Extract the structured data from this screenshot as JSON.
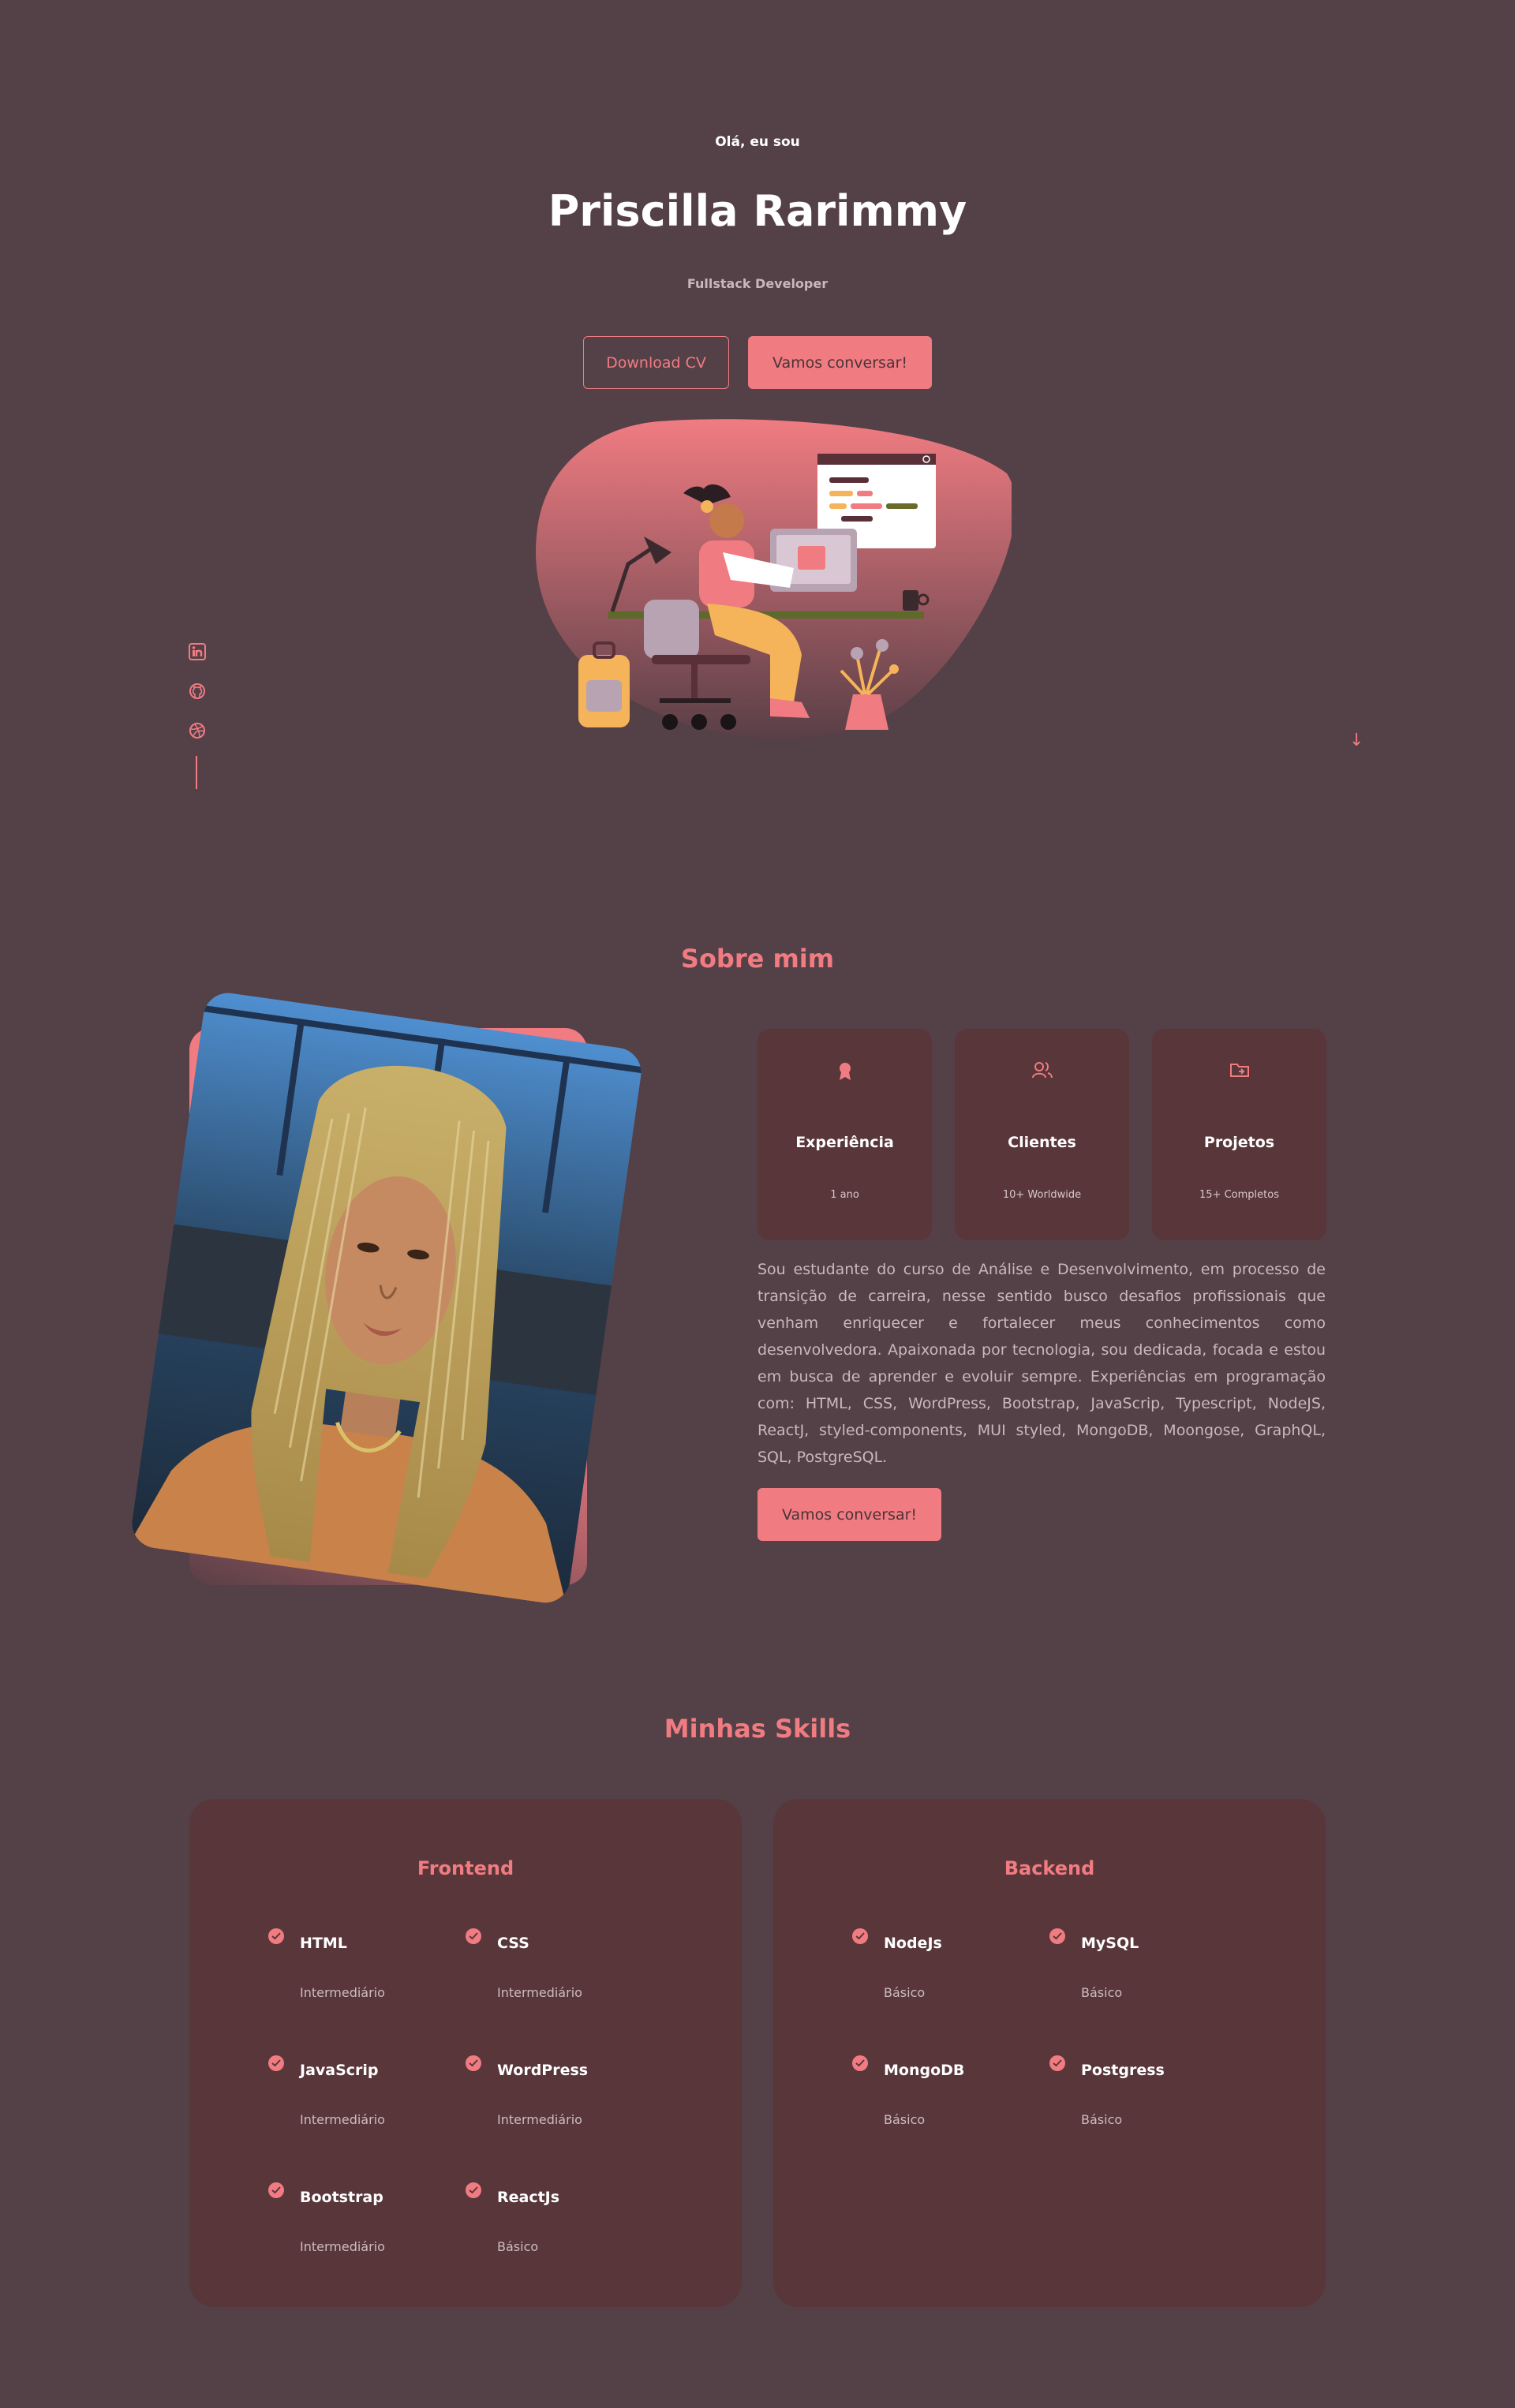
{
  "hero": {
    "greeting": "Olá, eu sou",
    "name": "Priscilla Rarimmy",
    "role": "Fullstack Developer",
    "download_cv_label": "Download CV",
    "contact_label": "Vamos conversar!"
  },
  "social": {
    "icons": [
      "linkedin-icon",
      "github-icon",
      "dribbble-icon"
    ]
  },
  "about": {
    "title": "Sobre mim",
    "cards": [
      {
        "icon": "award-icon",
        "title": "Experiência",
        "subtitle": "1 ano"
      },
      {
        "icon": "users-icon",
        "title": "Clientes",
        "subtitle": "10+ Worldwide"
      },
      {
        "icon": "folder-icon",
        "title": "Projetos",
        "subtitle": "15+ Completos"
      }
    ],
    "description": "Sou estudante do curso de Análise e Desenvolvimento, em processo de transição de carreira, nesse sentido busco desafios profissionais que venham enriquecer e fortalecer meus conhecimentos como desenvolvedora. Apaixonada por tecnologia, sou dedicada, focada e estou em busca de aprender e evoluir sempre. Experiências em programação com: HTML, CSS, WordPress, Bootstrap, JavaScrip, Typescript, NodeJS, ReactJ, styled-components, MUI styled, MongoDB, Moongose, GraphQL, SQL, PostgreSQL.",
    "contact_label": "Vamos conversar!"
  },
  "skills": {
    "title": "Minhas Skills",
    "frontend": {
      "title": "Frontend",
      "items": [
        {
          "name": "HTML",
          "level": "Intermediário"
        },
        {
          "name": "CSS",
          "level": "Intermediário"
        },
        {
          "name": "JavaScrip",
          "level": "Intermediário"
        },
        {
          "name": "WordPress",
          "level": "Intermediário"
        },
        {
          "name": "Bootstrap",
          "level": "Intermediário"
        },
        {
          "name": "ReactJs",
          "level": "Básico"
        }
      ]
    },
    "backend": {
      "title": "Backend",
      "items": [
        {
          "name": "NodeJs",
          "level": "Básico"
        },
        {
          "name": "MySQL",
          "level": "Básico"
        },
        {
          "name": "MongoDB",
          "level": "Básico"
        },
        {
          "name": "Postgress",
          "level": "Básico"
        }
      ]
    }
  },
  "colors": {
    "background": "#544047",
    "accent": "#f07c82",
    "card": "#58363a"
  }
}
